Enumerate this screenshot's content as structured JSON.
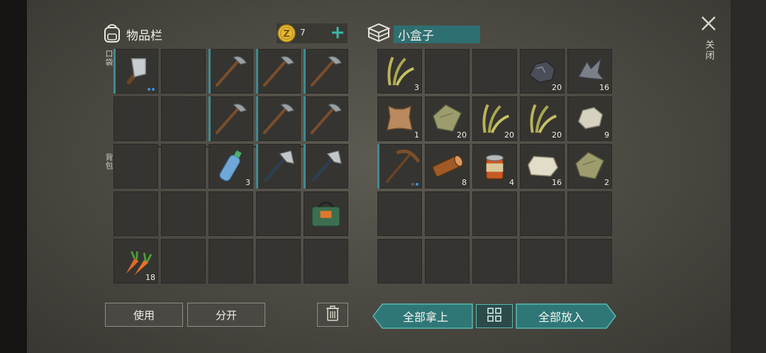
{
  "inventory": {
    "title": "物品栏",
    "coin_count": "7",
    "pocket_label": "口袋",
    "backpack_label": "背包",
    "use_label": "使用",
    "split_label": "分开"
  },
  "box": {
    "title": "小盒子",
    "take_all_label": "全部拿上",
    "put_all_label": "全部放入"
  },
  "close_label": "关闭",
  "left_slots": [
    {
      "item": "cleaver-icon",
      "qty": "",
      "bar": true,
      "dots": true
    },
    {
      "item": "",
      "qty": "",
      "bar": false
    },
    {
      "item": "stone-pickaxe-icon",
      "qty": "",
      "bar": true,
      "barshort": true
    },
    {
      "item": "stone-pickaxe-icon",
      "qty": "",
      "bar": true
    },
    {
      "item": "stone-pickaxe-icon",
      "qty": "",
      "bar": true
    },
    {
      "item": "",
      "qty": "",
      "bar": false
    },
    {
      "item": "",
      "qty": "",
      "bar": false
    },
    {
      "item": "stone-pickaxe-icon",
      "qty": "",
      "bar": true
    },
    {
      "item": "stone-pickaxe-icon",
      "qty": "",
      "bar": true
    },
    {
      "item": "stone-pickaxe-icon",
      "qty": "",
      "bar": true
    },
    {
      "item": "",
      "qty": "",
      "bar": false
    },
    {
      "item": "",
      "qty": "",
      "bar": false
    },
    {
      "item": "water-bottle-icon",
      "qty": "3",
      "bar": false
    },
    {
      "item": "hatchet-icon",
      "qty": "",
      "bar": true
    },
    {
      "item": "hatchet-icon",
      "qty": "",
      "bar": true
    },
    {
      "item": "",
      "qty": "",
      "bar": false
    },
    {
      "item": "",
      "qty": "",
      "bar": false
    },
    {
      "item": "",
      "qty": "",
      "bar": false
    },
    {
      "item": "",
      "qty": "",
      "bar": false
    },
    {
      "item": "green-bag-icon",
      "qty": "",
      "bar": false
    },
    {
      "item": "carrot-icon",
      "qty": "18",
      "bar": false
    },
    {
      "item": "",
      "qty": "",
      "bar": false
    },
    {
      "item": "",
      "qty": "",
      "bar": false
    },
    {
      "item": "",
      "qty": "",
      "bar": false
    },
    {
      "item": "",
      "qty": "",
      "bar": false
    }
  ],
  "right_slots": [
    {
      "item": "plant-fiber-icon",
      "qty": "3",
      "bar": false
    },
    {
      "item": "",
      "qty": "",
      "bar": false
    },
    {
      "item": "",
      "qty": "",
      "bar": false
    },
    {
      "item": "coal-ore-icon",
      "qty": "20",
      "bar": false
    },
    {
      "item": "iron-ore-icon",
      "qty": "16",
      "bar": false
    },
    {
      "item": "leather-icon",
      "qty": "1",
      "bar": false
    },
    {
      "item": "cloth-icon",
      "qty": "20",
      "bar": false
    },
    {
      "item": "plant-fiber-icon",
      "qty": "20",
      "bar": false
    },
    {
      "item": "plant-fiber-icon",
      "qty": "20",
      "bar": false
    },
    {
      "item": "stone-icon",
      "qty": "9",
      "bar": false
    },
    {
      "item": "pickaxe-icon",
      "qty": "",
      "bar": true,
      "dots": true
    },
    {
      "item": "log-icon",
      "qty": "8",
      "bar": false
    },
    {
      "item": "canned-food-icon",
      "qty": "4",
      "bar": false
    },
    {
      "item": "limestone-icon",
      "qty": "16",
      "bar": false
    },
    {
      "item": "cloth-icon",
      "qty": "2",
      "bar": false
    },
    {
      "item": "",
      "qty": "",
      "bar": false
    },
    {
      "item": "",
      "qty": "",
      "bar": false
    },
    {
      "item": "",
      "qty": "",
      "bar": false
    },
    {
      "item": "",
      "qty": "",
      "bar": false
    },
    {
      "item": "",
      "qty": "",
      "bar": false
    },
    {
      "item": "",
      "qty": "",
      "bar": false
    },
    {
      "item": "",
      "qty": "",
      "bar": false
    },
    {
      "item": "",
      "qty": "",
      "bar": false
    },
    {
      "item": "",
      "qty": "",
      "bar": false
    },
    {
      "item": "",
      "qty": "",
      "bar": false
    }
  ],
  "colors": {
    "accent": "#3f8a92",
    "teal_button": "#2f7777",
    "coin": "#e5b932"
  }
}
